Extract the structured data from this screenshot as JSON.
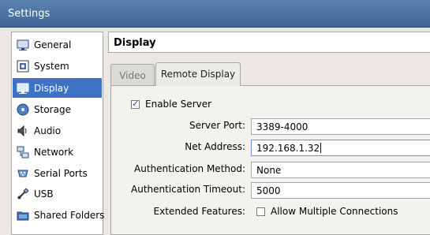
{
  "window": {
    "title": "Settings"
  },
  "sidebar": {
    "items": [
      {
        "label": "General",
        "icon": "monitor-icon"
      },
      {
        "label": "System",
        "icon": "chip-icon"
      },
      {
        "label": "Display",
        "icon": "display-icon",
        "active": true
      },
      {
        "label": "Storage",
        "icon": "disk-icon"
      },
      {
        "label": "Audio",
        "icon": "speaker-icon"
      },
      {
        "label": "Network",
        "icon": "network-icon"
      },
      {
        "label": "Serial Ports",
        "icon": "serial-port-icon"
      },
      {
        "label": "USB",
        "icon": "usb-icon"
      },
      {
        "label": "Shared Folders",
        "icon": "folder-icon"
      }
    ]
  },
  "page": {
    "title": "Display"
  },
  "tabs": [
    {
      "label": "Video",
      "active": false
    },
    {
      "label": "Remote Display",
      "active": true
    }
  ],
  "form": {
    "enable_server": {
      "label": "Enable Server",
      "checked": true
    },
    "server_port": {
      "label": "Server Port:",
      "value": "3389-4000"
    },
    "net_address": {
      "label": "Net Address:",
      "value": "192.168.1.32"
    },
    "auth_method": {
      "label": "Authentication Method:",
      "value": "None"
    },
    "auth_timeout": {
      "label": "Authentication Timeout:",
      "value": "5000"
    },
    "extended_features": {
      "label": "Extended Features:"
    },
    "allow_multiple": {
      "label": "Allow Multiple Connections",
      "checked": false
    }
  },
  "colors": {
    "titlebar": "#4a72a3",
    "selection": "#3d73c4",
    "field_border": "#a6a6a6"
  }
}
